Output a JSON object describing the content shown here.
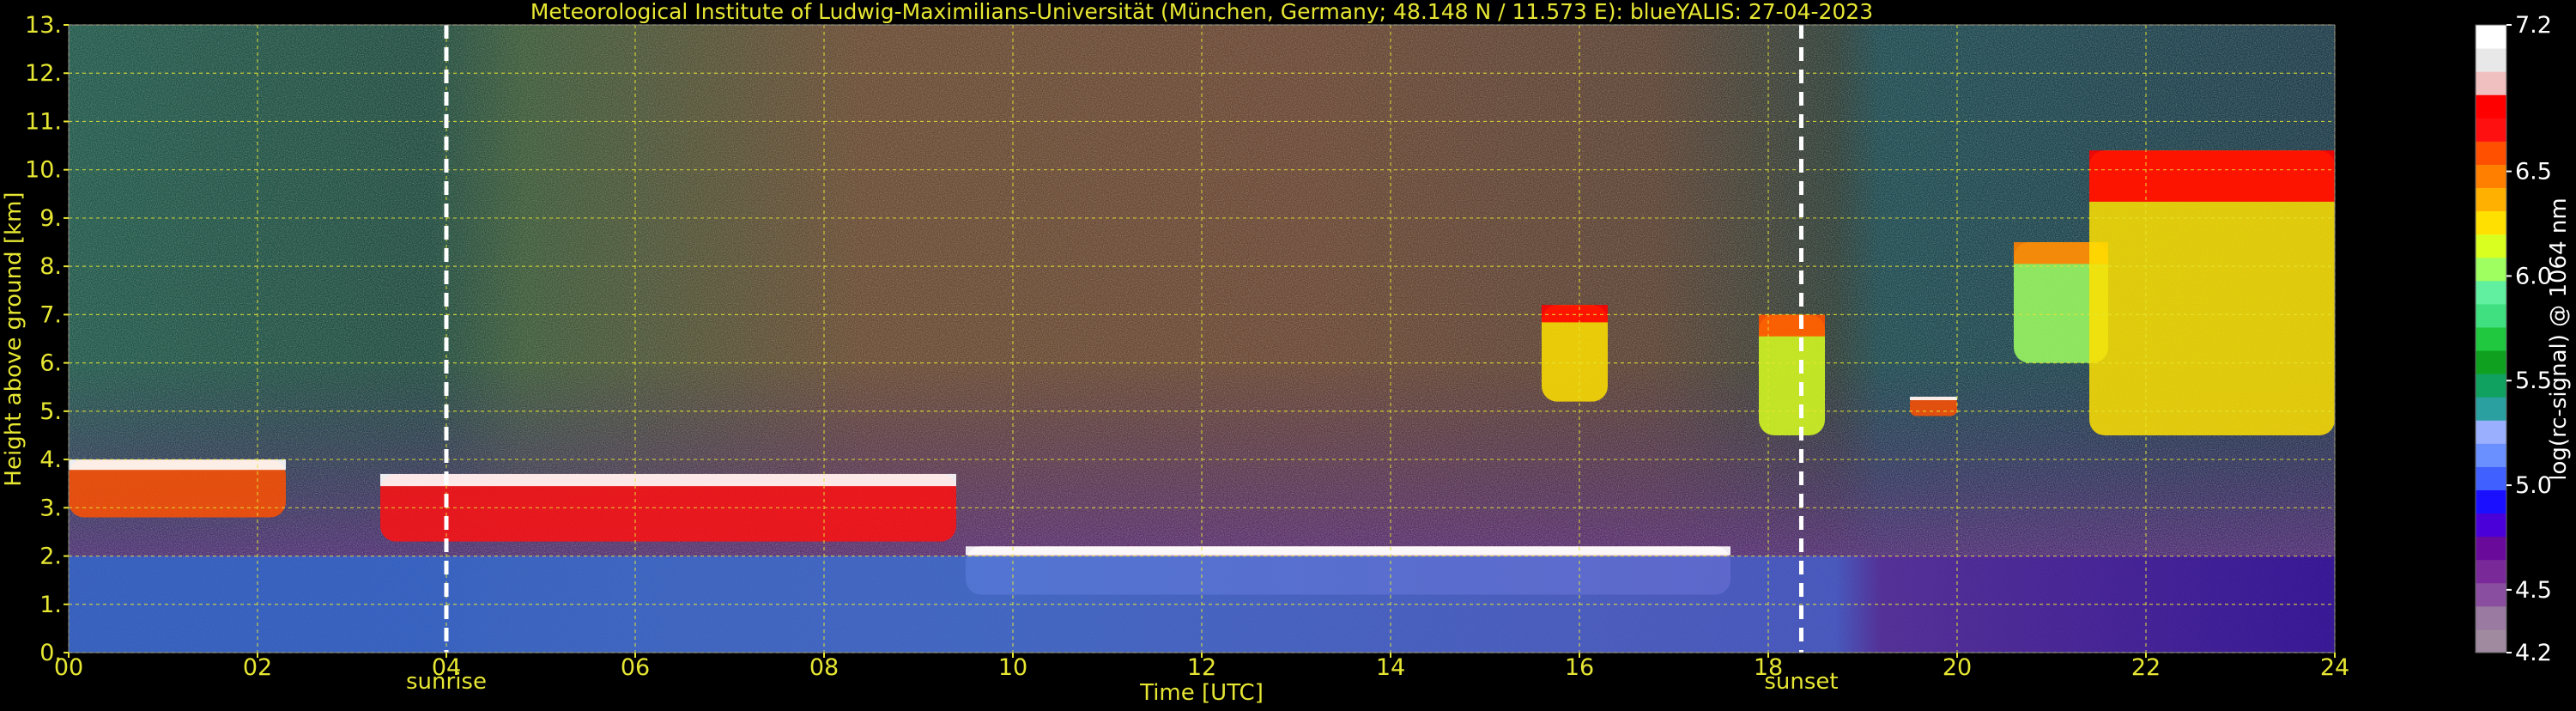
{
  "chart_data": {
    "type": "heatmap",
    "title": "Meteorological Institute of Ludwig-Maximilians-Universität (München, Germany; 48.148 N / 11.573 E):    blueYALIS: 27-04-2023",
    "xlabel": "Time [UTC]",
    "ylabel": "Height above ground [km]",
    "colorbar_label": "log(rc-signal) @ 1064 nm",
    "xlim": [
      0,
      24
    ],
    "ylim": [
      0,
      13
    ],
    "clim": [
      4.2,
      7.2
    ],
    "x_ticks": [
      "00",
      "02",
      "04",
      "06",
      "08",
      "10",
      "12",
      "14",
      "16",
      "18",
      "20",
      "22",
      "24"
    ],
    "y_ticks": [
      "0.",
      "1.",
      "2.",
      "3.",
      "4.",
      "5.",
      "6.",
      "7.",
      "8.",
      "9.",
      "10.",
      "11.",
      "12.",
      "13."
    ],
    "colorbar_ticks": [
      "4.2",
      "4.5",
      "5.0",
      "5.5",
      "6.0",
      "6.5",
      "7.2"
    ],
    "grid": true,
    "markers": [
      {
        "time": 4.0,
        "label": "sunrise"
      },
      {
        "time": 18.35,
        "label": "sunset"
      }
    ],
    "colormap": [
      "#a08aa0",
      "#9a7aa0",
      "#8a4ea0",
      "#7a2a98",
      "#6a0a9a",
      "#4a00d8",
      "#1a10ff",
      "#4060ff",
      "#6a90ff",
      "#9ab0ff",
      "#2aa0a0",
      "#10a060",
      "#10a020",
      "#20c840",
      "#40e080",
      "#60f0a0",
      "#a0ff60",
      "#d8ff20",
      "#ffe000",
      "#ffb000",
      "#ff8000",
      "#ff5000",
      "#ff1010",
      "#ff0000",
      "#f0c0c0",
      "#e8e8e8",
      "#ffffff"
    ],
    "features": [
      {
        "kind": "aerosol_layer",
        "t": [
          0.0,
          2.3
        ],
        "z": [
          2.8,
          4.0
        ],
        "level": 6.6
      },
      {
        "kind": "aerosol_layer",
        "t": [
          3.3,
          9.4
        ],
        "z": [
          2.3,
          3.7
        ],
        "level": 6.7
      },
      {
        "kind": "boundary_layer_top",
        "t": [
          9.5,
          17.6
        ],
        "z": [
          1.2,
          2.2
        ],
        "level": 6.9
      },
      {
        "kind": "lower_layer",
        "t": [
          0.0,
          24.0
        ],
        "z": [
          0.0,
          2.0
        ],
        "level": 5.0
      },
      {
        "kind": "cirrus",
        "t": [
          15.6,
          16.3
        ],
        "z": [
          5.2,
          7.2
        ],
        "level": 6.3
      },
      {
        "kind": "cirrus",
        "t": [
          17.9,
          18.6
        ],
        "z": [
          4.5,
          7.0
        ],
        "level": 6.1
      },
      {
        "kind": "cirrus",
        "t": [
          19.5,
          20.0
        ],
        "z": [
          4.9,
          5.3
        ],
        "level": 6.6
      },
      {
        "kind": "cirrus",
        "t": [
          20.6,
          21.6
        ],
        "z": [
          6.0,
          8.5
        ],
        "level": 6.0
      },
      {
        "kind": "cirrus",
        "t": [
          21.4,
          24.0
        ],
        "z": [
          4.5,
          10.4
        ],
        "level": 6.3
      }
    ]
  }
}
